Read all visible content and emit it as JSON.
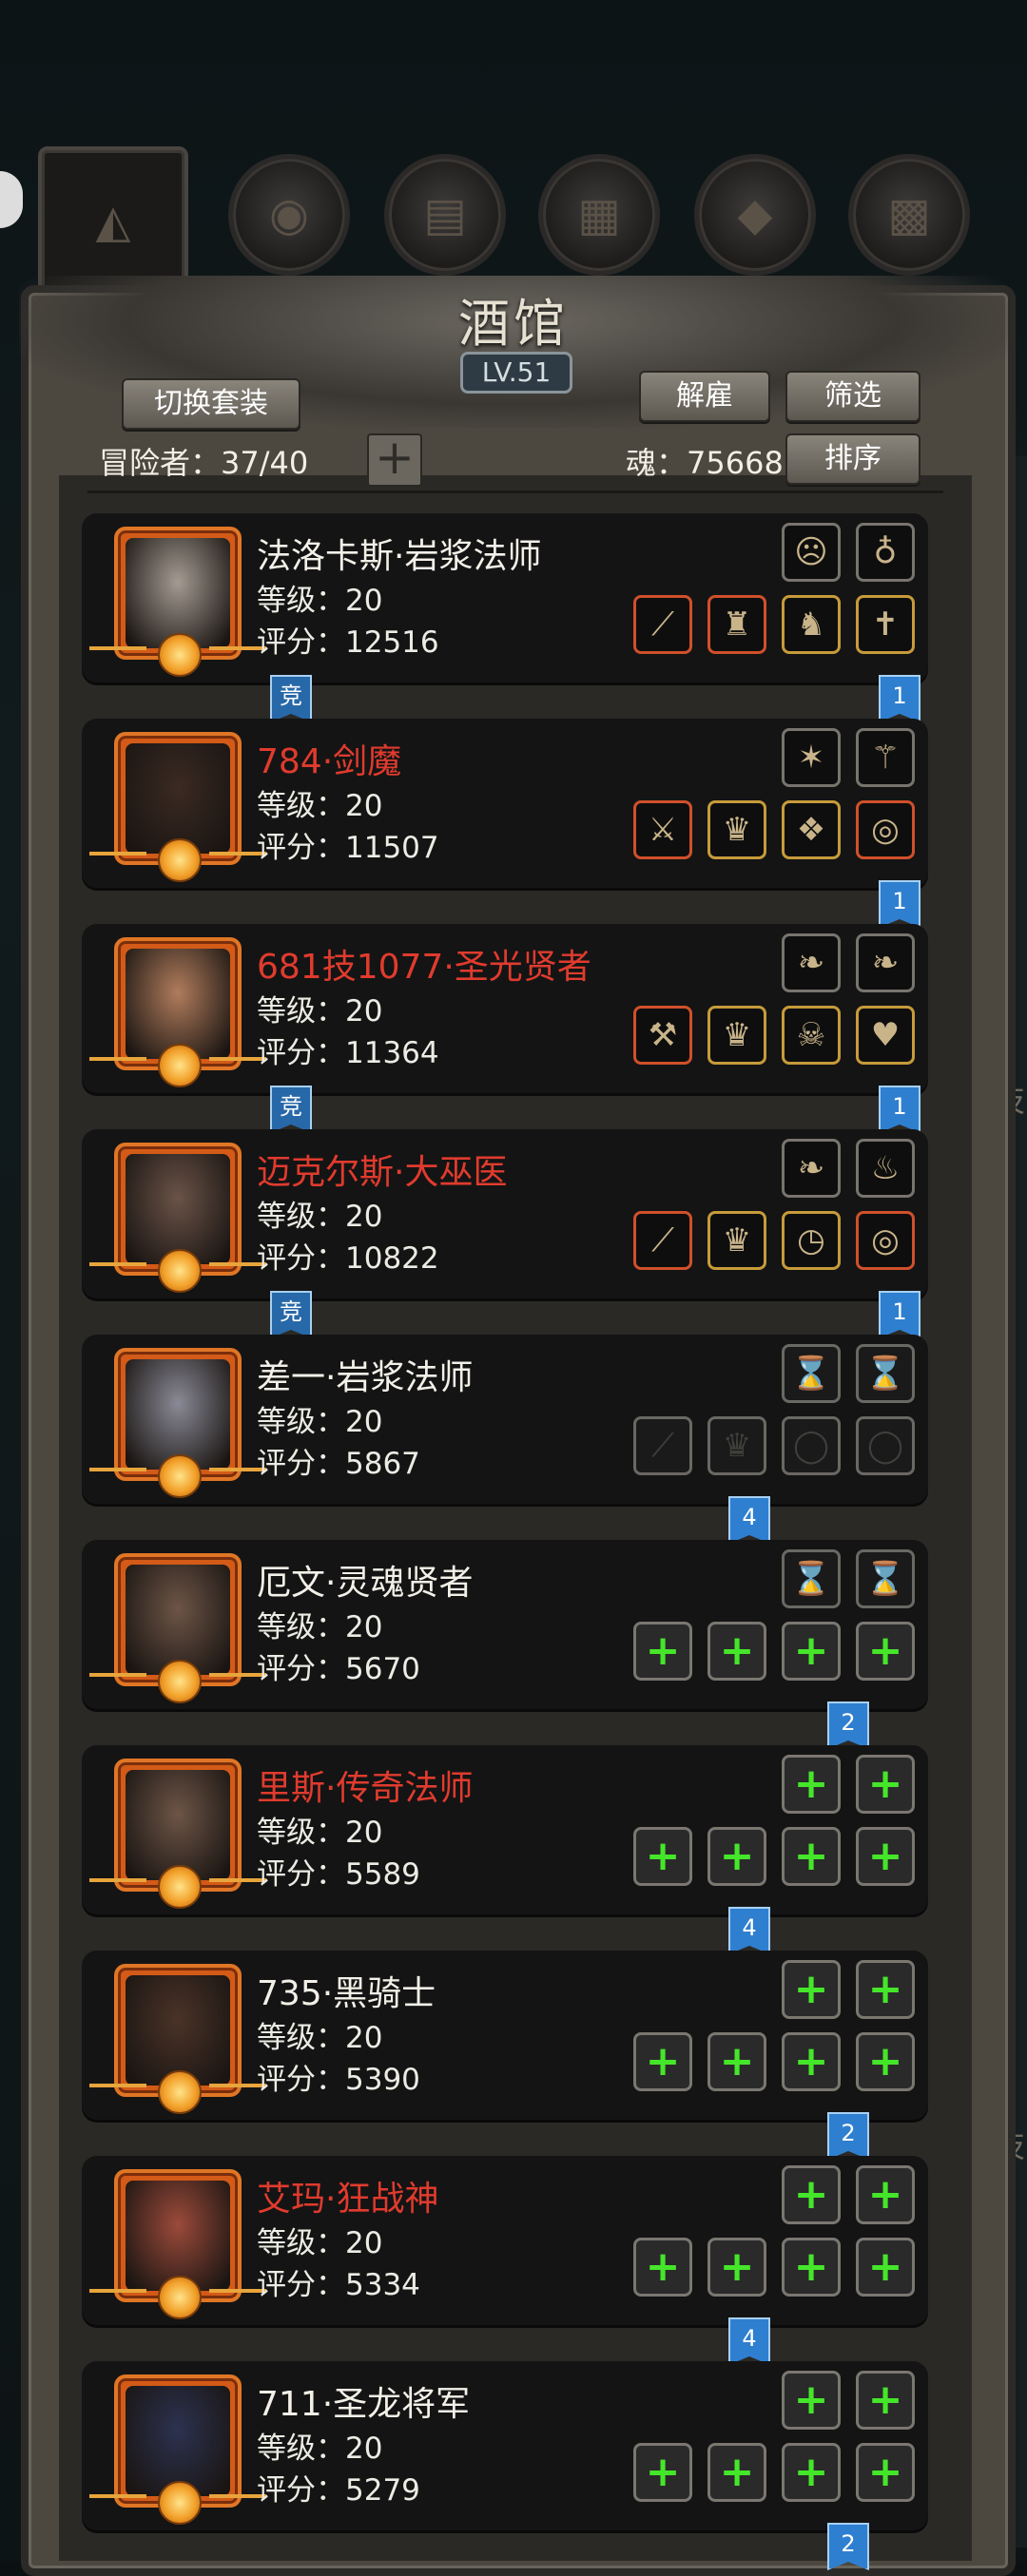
{
  "tavern": {
    "title": "酒馆",
    "level": "LV.51",
    "switch_outfit_label": "切换套装",
    "dismiss_label": "解雇",
    "filter_label": "筛选",
    "sort_label": "排序",
    "adventurer_count": "冒险者：37/40",
    "add_label": "+",
    "soul_count": "魂：75668"
  },
  "side_labels": [
    "技",
    "技"
  ],
  "heroes": [
    {
      "name": "法洛卡斯·岩浆法师",
      "name_color": "white",
      "level": "等级：20",
      "score": "评分：12516",
      "badge_left": "竞",
      "badge_right": "1",
      "top_slots": [
        "mask-icon",
        "potion-icon"
      ],
      "bottom_slots": [
        "staff-icon",
        "helmet-icon",
        "cloak-icon",
        "amulet-icon"
      ]
    },
    {
      "name": "784·剑魔",
      "name_color": "red",
      "level": "等级：20",
      "score": "评分：11507",
      "badge_left": "",
      "badge_right": "1",
      "top_slots": [
        "rune-icon",
        "scepter-icon"
      ],
      "bottom_slots": [
        "sword-icon",
        "armor-icon",
        "gem-icon",
        "ring-icon"
      ]
    },
    {
      "name": "681技1077·圣光贤者",
      "name_color": "red",
      "level": "等级：20",
      "score": "评分：11364",
      "badge_left": "竞",
      "badge_right": "1",
      "top_slots": [
        "feather-icon",
        "feather-icon"
      ],
      "bottom_slots": [
        "hammer-icon",
        "armor-icon",
        "skull-icon",
        "heart-icon"
      ]
    },
    {
      "name": "迈克尔斯·大巫医",
      "name_color": "red",
      "level": "等级：20",
      "score": "评分：10822",
      "badge_left": "竞",
      "badge_right": "1",
      "top_slots": [
        "feather-icon",
        "lantern-icon"
      ],
      "bottom_slots": [
        "wand-icon",
        "armor-icon",
        "clock-icon",
        "ring-icon"
      ]
    },
    {
      "name": "差一·岩浆法师",
      "name_color": "white",
      "level": "等级：20",
      "score": "评分：5867",
      "badge_left": "",
      "badge_right": "4",
      "top_slots": [
        "empty-slot-icon",
        "empty-slot-icon"
      ],
      "bottom_slots": [
        "staff-empty-icon",
        "armor-empty-icon",
        "ring-empty-icon",
        "ring-empty-icon"
      ]
    },
    {
      "name": "厄文·灵魂贤者",
      "name_color": "white",
      "level": "等级：20",
      "score": "评分：5670",
      "badge_left": "",
      "badge_right": "2",
      "top_slots": [
        "empty-slot-icon",
        "empty-slot-icon"
      ],
      "bottom_slots": [
        "add-icon",
        "add-icon",
        "add-icon",
        "add-icon"
      ]
    },
    {
      "name": "里斯·传奇法师",
      "name_color": "red",
      "level": "等级：20",
      "score": "评分：5589",
      "badge_left": "",
      "badge_right": "4",
      "top_slots": [
        "add-icon",
        "add-icon"
      ],
      "bottom_slots": [
        "add-icon",
        "add-icon",
        "add-icon",
        "add-icon"
      ]
    },
    {
      "name": "735·黑骑士",
      "name_color": "white",
      "level": "等级：20",
      "score": "评分：5390",
      "badge_left": "",
      "badge_right": "2",
      "top_slots": [
        "add-icon",
        "add-icon"
      ],
      "bottom_slots": [
        "add-icon",
        "add-icon",
        "add-icon",
        "add-icon"
      ]
    },
    {
      "name": "艾玛·狂战神",
      "name_color": "red",
      "level": "等级：20",
      "score": "评分：5334",
      "badge_left": "",
      "badge_right": "4",
      "top_slots": [
        "add-icon",
        "add-icon"
      ],
      "bottom_slots": [
        "add-icon",
        "add-icon",
        "add-icon",
        "add-icon"
      ]
    },
    {
      "name": "711·圣龙将军",
      "name_color": "white",
      "level": "等级：20",
      "score": "评分：5279",
      "badge_left": "",
      "badge_right": "2",
      "top_slots": [
        "add-icon",
        "add-icon"
      ],
      "bottom_slots": [
        "add-icon",
        "add-icon",
        "add-icon",
        "add-icon"
      ]
    }
  ]
}
